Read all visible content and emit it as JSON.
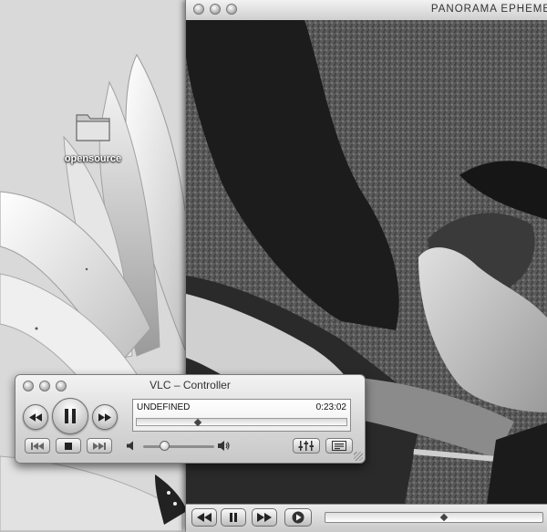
{
  "desktop": {
    "folder_label": "opensource"
  },
  "video_window": {
    "title": "PANORAMA EPHEME",
    "playback_position": 0.55
  },
  "controller": {
    "title": "VLC – Controller",
    "now_playing": "UNDEFINED",
    "time": "0:23:02",
    "position": 0.29,
    "volume": 0.29
  },
  "icons": {
    "rewind": "rewind-icon",
    "pause": "pause-icon",
    "fast_forward": "fast-forward-icon",
    "previous": "previous-track-icon",
    "stop": "stop-icon",
    "next": "next-track-icon",
    "volume_low": "speaker-low-icon",
    "volume_high": "speaker-high-icon",
    "equalizer": "equalizer-icon",
    "playlist": "playlist-icon",
    "play": "play-icon"
  }
}
